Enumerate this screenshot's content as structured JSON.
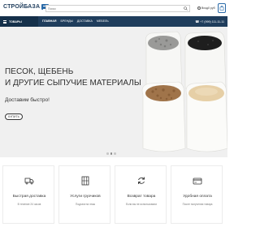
{
  "header": {
    "logo_text": "СТРОЙБАЗА",
    "search_placeholder": "Поиск",
    "login_label": "Вход",
    "cart_total": "0 руб"
  },
  "nav": {
    "goods_label": "ТОВАРЫ",
    "links": [
      "Главная",
      "Бренды",
      "Доставка",
      "Мебель"
    ],
    "phone": "+7 (999) 111-11-11"
  },
  "hero": {
    "title_line1": "ПЕСОК, ЩЕБЕНЬ",
    "title_line2": "И ДРУГИЕ СЫПУЧИЕ МАТЕРИАЛЫ",
    "subtitle": "Доставим быстро!",
    "button_label": "Купить",
    "slides_count": 3,
    "active_slide": 1
  },
  "features": [
    {
      "icon": "truck-icon",
      "title": "Быстрая доставка",
      "subtitle": "В течение 24 часов"
    },
    {
      "icon": "box-icon",
      "title": "Услуги грузчиков",
      "subtitle": "Подъем на этаж"
    },
    {
      "icon": "refresh-icon",
      "title": "Возврат товара",
      "subtitle": "Если вы не использовали"
    },
    {
      "icon": "card-icon",
      "title": "Удобная оплата",
      "subtitle": "После получения товара"
    }
  ],
  "colors": {
    "brand": "#1f3d5c",
    "accent": "#2a6aa8"
  }
}
